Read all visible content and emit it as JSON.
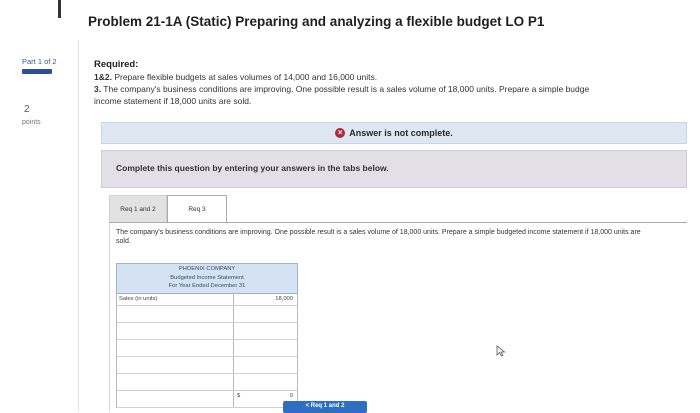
{
  "title": "Problem 21-1A (Static) Preparing and analyzing a flexible budget LO P1",
  "sidebar": {
    "part_label": "Part 1 of 2",
    "points_value": "2",
    "points_label": "points"
  },
  "required": {
    "heading": "Required:",
    "item1_number": "1&2.",
    "item1_text": " Prepare flexible budgets at sales volumes of 14,000 and 16,000 units.",
    "item3_number": "3.",
    "item3_text": " The company's business conditions are improving. One possible result is a sales volume of 18,000 units. Prepare a simple budge",
    "item3_text_cont": "income statement if 18,000 units are sold."
  },
  "status": {
    "icon": "x-circle-icon",
    "message": "Answer is not complete."
  },
  "instruction": "Complete this question by entering your answers in the tabs below.",
  "tabs": [
    {
      "label": "Req 1 and 2"
    },
    {
      "label": "Req 3"
    }
  ],
  "panel": {
    "text": "The company's business conditions are improving. One possible result is a sales volume of 18,000 units. Prepare a simple budgeted income statement if 18,000 units are sold."
  },
  "statement": {
    "company": "PHOENIX COMPANY",
    "name": "Budgeted Income Statement",
    "period": "For Year Ended December 31",
    "rows": [
      {
        "label": "Sales (in units)",
        "value": "18,000"
      },
      {
        "label": "",
        "value": ""
      },
      {
        "label": "",
        "value": ""
      },
      {
        "label": "",
        "value": ""
      },
      {
        "label": "",
        "value": ""
      },
      {
        "label": "",
        "value": ""
      }
    ],
    "total_currency": "$",
    "total_value": "0"
  },
  "next_button": "< Req 1 and 2",
  "colors": {
    "accent_blue": "#2f4f9a",
    "error_red": "#b22a3a",
    "header_blue": "#d4e2f3"
  }
}
